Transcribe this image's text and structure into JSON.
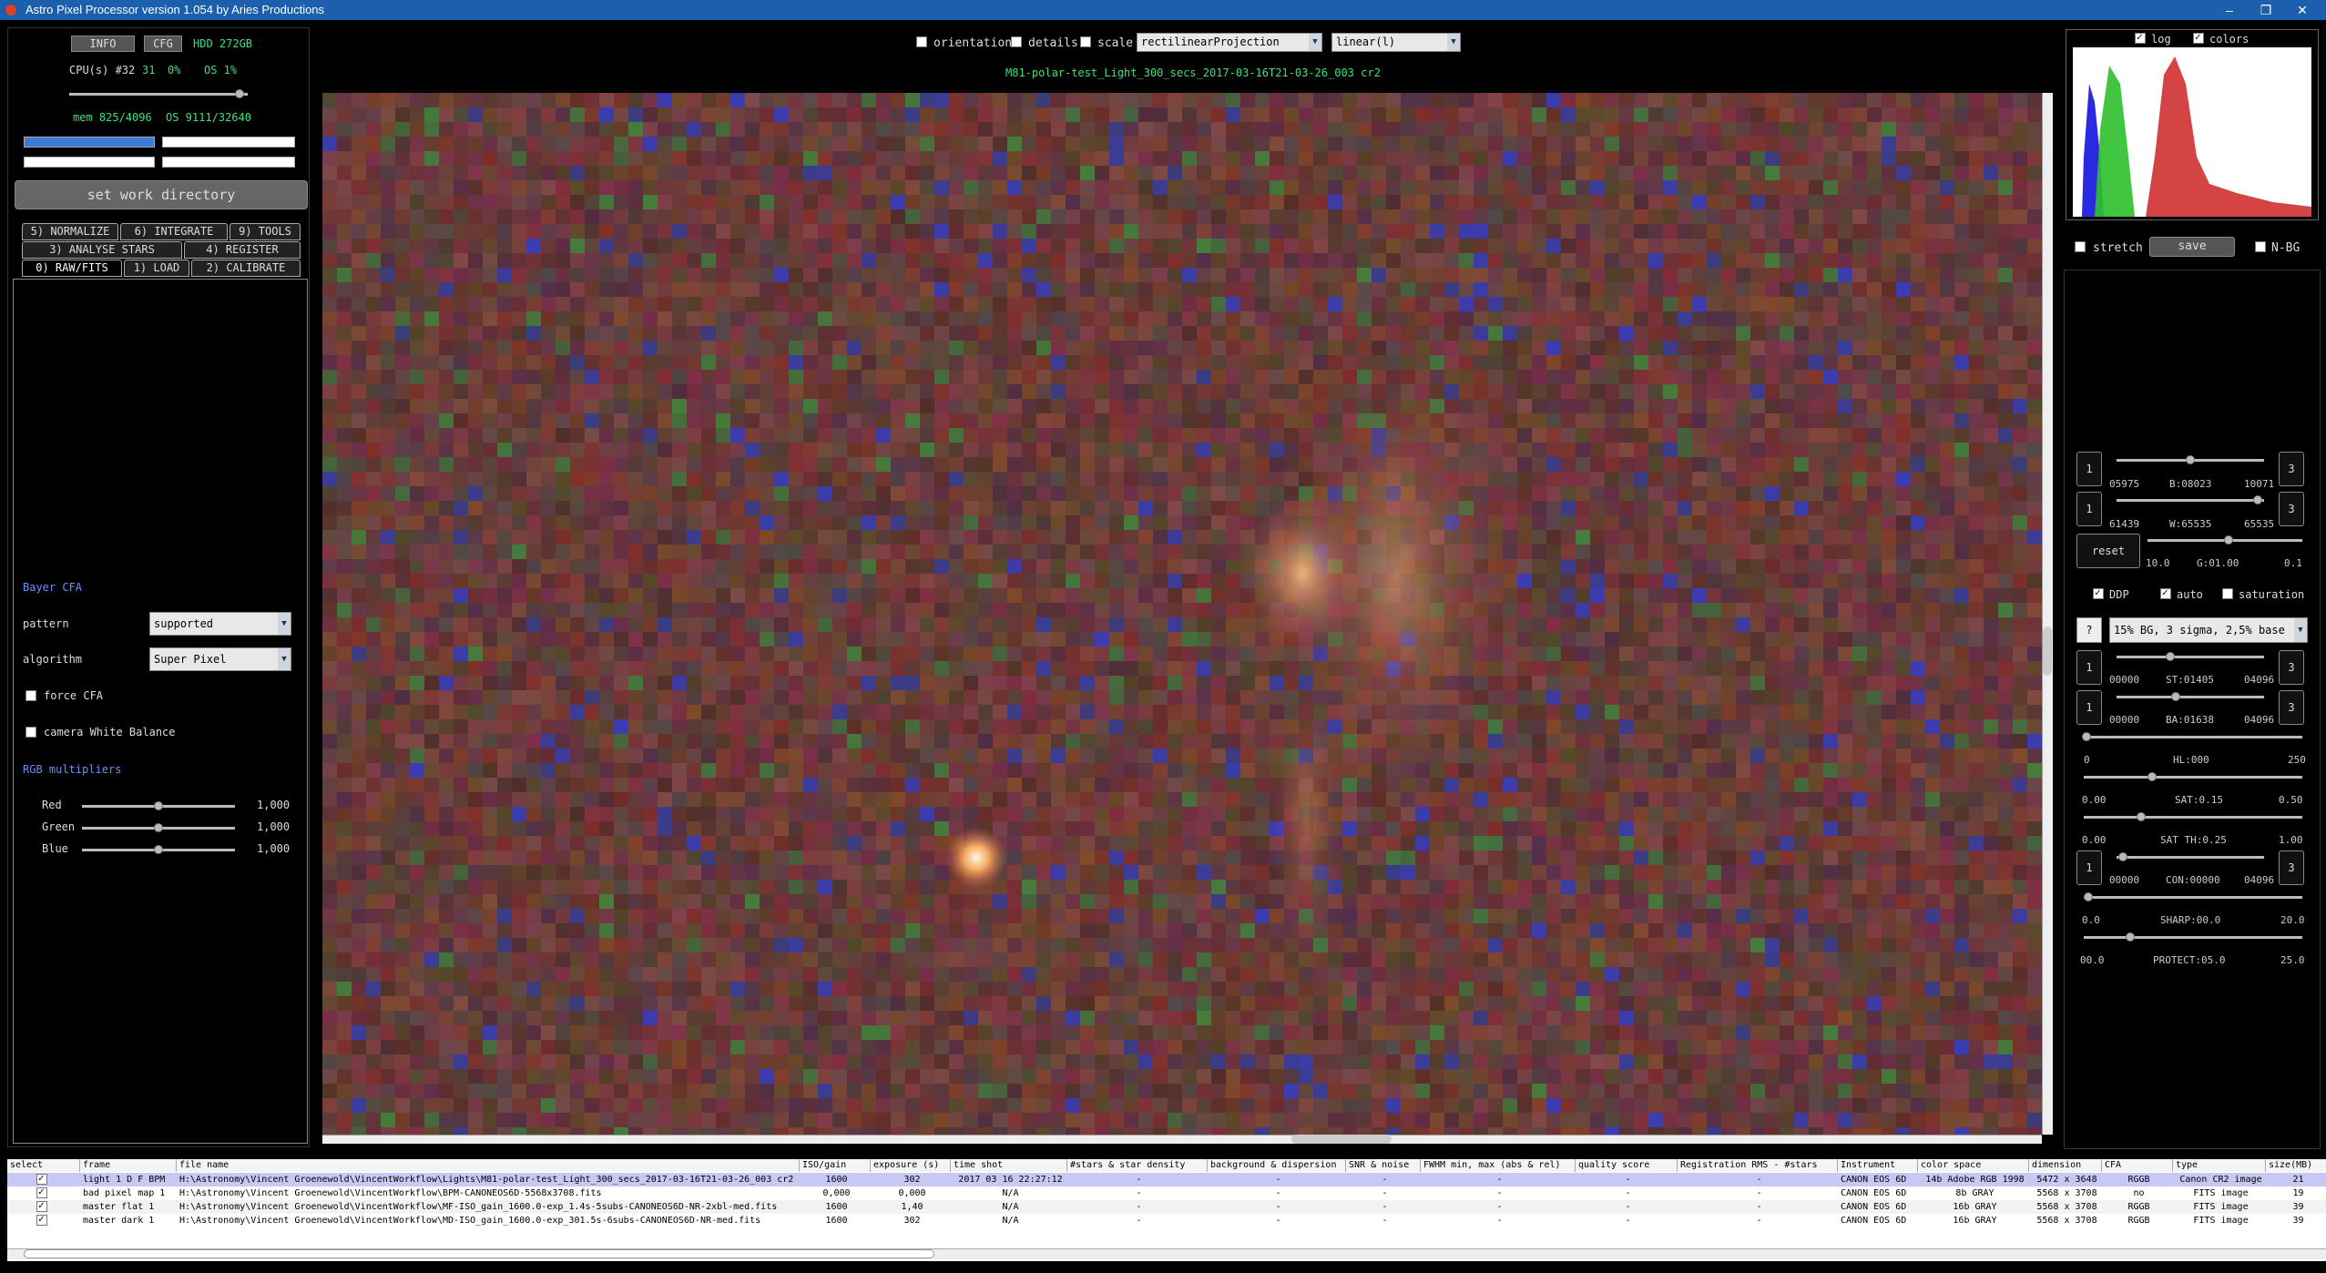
{
  "window": {
    "title": "Astro Pixel Processor version 1.054 by Aries Productions",
    "min": "–",
    "max": "❐",
    "close": "✕"
  },
  "sys": {
    "info": "INFO",
    "cfg": "CFG",
    "hdd": "HDD 272GB",
    "cpu_label": "CPU(s) #32",
    "cpu_val": "31",
    "cpu_pct": "0%",
    "os": "OS 1%",
    "mem": "mem 825/4096",
    "os_mem": "OS 9111/32640"
  },
  "workdir": "set work directory",
  "tabs": {
    "row1": [
      "5) NORMALIZE",
      "6) INTEGRATE",
      "9) TOOLS"
    ],
    "row2": [
      "3) ANALYSE STARS",
      "4) REGISTER"
    ],
    "row3": [
      "0) RAW/FITS",
      "1) LOAD",
      "2) CALIBRATE"
    ]
  },
  "raw": {
    "bayer": "Bayer CFA",
    "pattern_label": "pattern",
    "pattern_val": "supported",
    "algorithm_label": "algorithm",
    "algorithm_val": "Super Pixel",
    "force_cfa": "force CFA",
    "cwb": "camera White Balance",
    "rgb_mult": "RGB multipliers",
    "red": "Red",
    "green": "Green",
    "blue": "Blue",
    "red_val": "1,000",
    "green_val": "1,000",
    "blue_val": "1,000"
  },
  "top": {
    "orientation": "orientation",
    "details": "details",
    "scale": "scale",
    "projection": "rectilinearProjection",
    "stretch_fn": "linear(l)",
    "filename": "M81-polar-test_Light_300_secs_2017-03-16T21-03-26_003 cr2"
  },
  "hist": {
    "log": "log",
    "colors": "colors",
    "stretch": "stretch",
    "save": "save",
    "nbg": "N-BG"
  },
  "right": {
    "b_min": "05975",
    "b_label": "B:08023",
    "b_max": "10071",
    "w_min": "61439",
    "w_label": "W:65535",
    "w_max": "65535",
    "reset": "reset",
    "g_min": "10.0",
    "g_label": "G:01.00",
    "g_max": "0.1",
    "ddp": "DDP",
    "auto": "auto",
    "saturation": "saturation",
    "q": "?",
    "preset": "15% BG, 3 sigma, 2,5% base",
    "st_min": "00000",
    "st_label": "ST:01405",
    "st_max": "04096",
    "ba_min": "00000",
    "ba_label": "BA:01638",
    "ba_max": "04096",
    "hl_min": "0",
    "hl_label": "HL:000",
    "hl_max": "250",
    "sat_min": "0.00",
    "sat_label": "SAT:0.15",
    "sat_max": "0.50",
    "satth_min": "0.00",
    "satth_label": "SAT TH:0.25",
    "satth_max": "1.00",
    "con_min": "00000",
    "con_label": "CON:00000",
    "con_max": "04096",
    "sharp_min": "0.0",
    "sharp_label": "SHARP:00.0",
    "sharp_max": "20.0",
    "prot_min": "00.0",
    "prot_label": "PROTECT:05.0",
    "prot_max": "25.0",
    "one": "1",
    "three": "3"
  },
  "table": {
    "headers": [
      "select",
      "frame",
      "file name",
      "ISO/gain",
      "exposure (s)",
      "time shot",
      "#stars & star density",
      "background & dispersion",
      "SNR & noise",
      "FWHM min, max (abs & rel)",
      "quality score",
      "Registration RMS - #stars",
      "Instrument",
      "color space",
      "dimension",
      "CFA",
      "type",
      "size(MB)"
    ],
    "rows": [
      [
        "",
        "light 1 D F BPM",
        "H:\\Astronomy\\Vincent Groenewold\\VincentWorkflow\\Lights\\M81-polar-test_Light_300_secs_2017-03-16T21-03-26_003 cr2",
        "1600",
        "302",
        "2017 03 16 22:27:12",
        "-",
        "-",
        "-",
        "-",
        "-",
        "-",
        "CANON EOS 6D",
        "14b Adobe RGB 1998",
        "5472 x 3648",
        "RGGB",
        "Canon CR2 image",
        "21"
      ],
      [
        "",
        "bad pixel map 1",
        "H:\\Astronomy\\Vincent Groenewold\\VincentWorkflow\\BPM-CANONEOS6D-5568x3708.fits",
        "0,000",
        "0,000",
        "N/A",
        "-",
        "-",
        "-",
        "-",
        "-",
        "-",
        "CANON EOS 6D",
        "8b GRAY",
        "5568 x 3708",
        "no",
        "FITS image",
        "19"
      ],
      [
        "",
        "master flat 1",
        "H:\\Astronomy\\Vincent Groenewold\\VincentWorkflow\\MF-ISO_gain_1600.0-exp_1.4s-5subs-CANONEOS6D-NR-2xbl-med.fits",
        "1600",
        "1,40",
        "N/A",
        "-",
        "-",
        "-",
        "-",
        "-",
        "-",
        "CANON EOS 6D",
        "16b GRAY",
        "5568 x 3708",
        "RGGB",
        "FITS image",
        "39"
      ],
      [
        "",
        "master dark 1",
        "H:\\Astronomy\\Vincent Groenewold\\VincentWorkflow\\MD-ISO_gain_1600.0-exp_301.5s-6subs-CANONEOS6D-NR-med.fits",
        "1600",
        "302",
        "N/A",
        "-",
        "-",
        "-",
        "-",
        "-",
        "-",
        "CANON EOS 6D",
        "16b GRAY",
        "5568 x 3708",
        "RGGB",
        "FITS image",
        "39"
      ]
    ]
  },
  "colors": {
    "green_text": "#3ee07a",
    "blue_text": "#6a8fff",
    "titlebar": "#1b5fad"
  }
}
